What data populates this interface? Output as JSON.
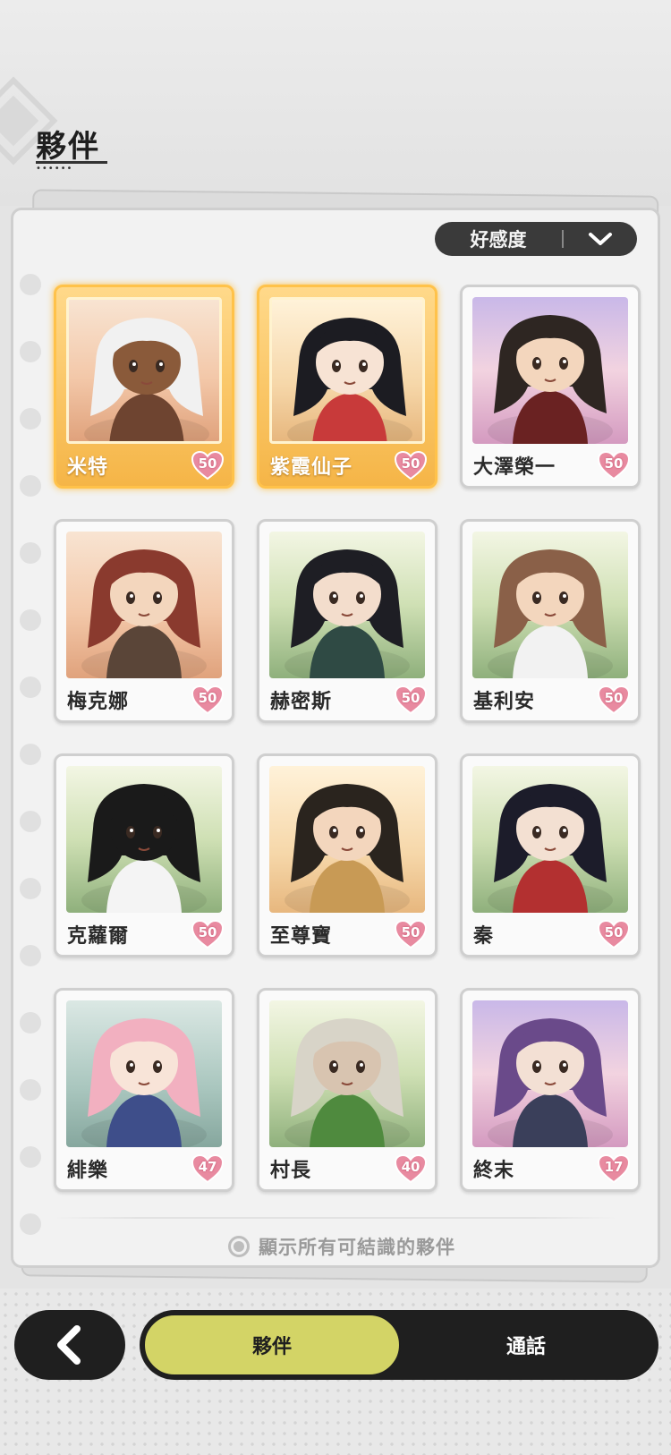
{
  "header": {
    "title": "夥伴"
  },
  "sort": {
    "label": "好感度",
    "icon": "chevron-down-icon"
  },
  "partners": [
    {
      "name": "米特",
      "affinity": "50",
      "highlighted": true,
      "bg": "desert",
      "hair": "#f1f1f1",
      "skin": "#8a5a3a",
      "outfit": "#6e4430"
    },
    {
      "name": "紫霞仙子",
      "affinity": "50",
      "highlighted": true,
      "bg": "temple",
      "hair": "#1c1c22",
      "skin": "#f7e3d4",
      "outfit": "#c83a3a"
    },
    {
      "name": "大澤榮一",
      "affinity": "50",
      "highlighted": false,
      "bg": "sky",
      "hair": "#2e2622",
      "skin": "#f3d6bd",
      "outfit": "#6a2222"
    },
    {
      "name": "梅克娜",
      "affinity": "50",
      "highlighted": false,
      "bg": "desert",
      "hair": "#8a3a2e",
      "skin": "#f3d6bd",
      "outfit": "#5a4538"
    },
    {
      "name": "赫密斯",
      "affinity": "50",
      "highlighted": false,
      "bg": "forest",
      "hair": "#1e1e24",
      "skin": "#f3ddcc",
      "outfit": "#2f4a44"
    },
    {
      "name": "基利安",
      "affinity": "50",
      "highlighted": false,
      "bg": "forest",
      "hair": "#8a6048",
      "skin": "#f3d6bd",
      "outfit": "#f2f2f2"
    },
    {
      "name": "克蘿爾",
      "affinity": "50",
      "highlighted": false,
      "bg": "forest",
      "hair": "#1a1a1a",
      "skin": "#1a1a1a",
      "outfit": "#f4f4f4"
    },
    {
      "name": "至尊寶",
      "affinity": "50",
      "highlighted": false,
      "bg": "temple",
      "hair": "#2a241e",
      "skin": "#f3d6bd",
      "outfit": "#c89a55"
    },
    {
      "name": "秦",
      "affinity": "50",
      "highlighted": false,
      "bg": "forest",
      "hair": "#1c1c2a",
      "skin": "#f3e0d2",
      "outfit": "#b33030"
    },
    {
      "name": "緋樂",
      "affinity": "47",
      "highlighted": false,
      "bg": "ruins",
      "hair": "#f2b0c0",
      "skin": "#f8e4d8",
      "outfit": "#3e4e8a"
    },
    {
      "name": "村長",
      "affinity": "40",
      "highlighted": false,
      "bg": "forest",
      "hair": "#d8d4c8",
      "skin": "#d8c4b0",
      "outfit": "#4f8a3e"
    },
    {
      "name": "終末",
      "affinity": "17",
      "highlighted": false,
      "bg": "sky",
      "hair": "#6a4a8a",
      "skin": "#f3e0d4",
      "outfit": "#3a3f5a"
    }
  ],
  "show_all": {
    "label": "顯示所有可結識的夥伴"
  },
  "bottom_nav": {
    "back_icon": "back-arrow-icon",
    "tabs": [
      {
        "label": "夥伴",
        "active": true
      },
      {
        "label": "通話",
        "active": false
      }
    ]
  },
  "colors": {
    "gold": "#f5b547",
    "active_tab": "#d3d466",
    "dark": "#1f1f1f",
    "heart": "#e88aa0"
  }
}
